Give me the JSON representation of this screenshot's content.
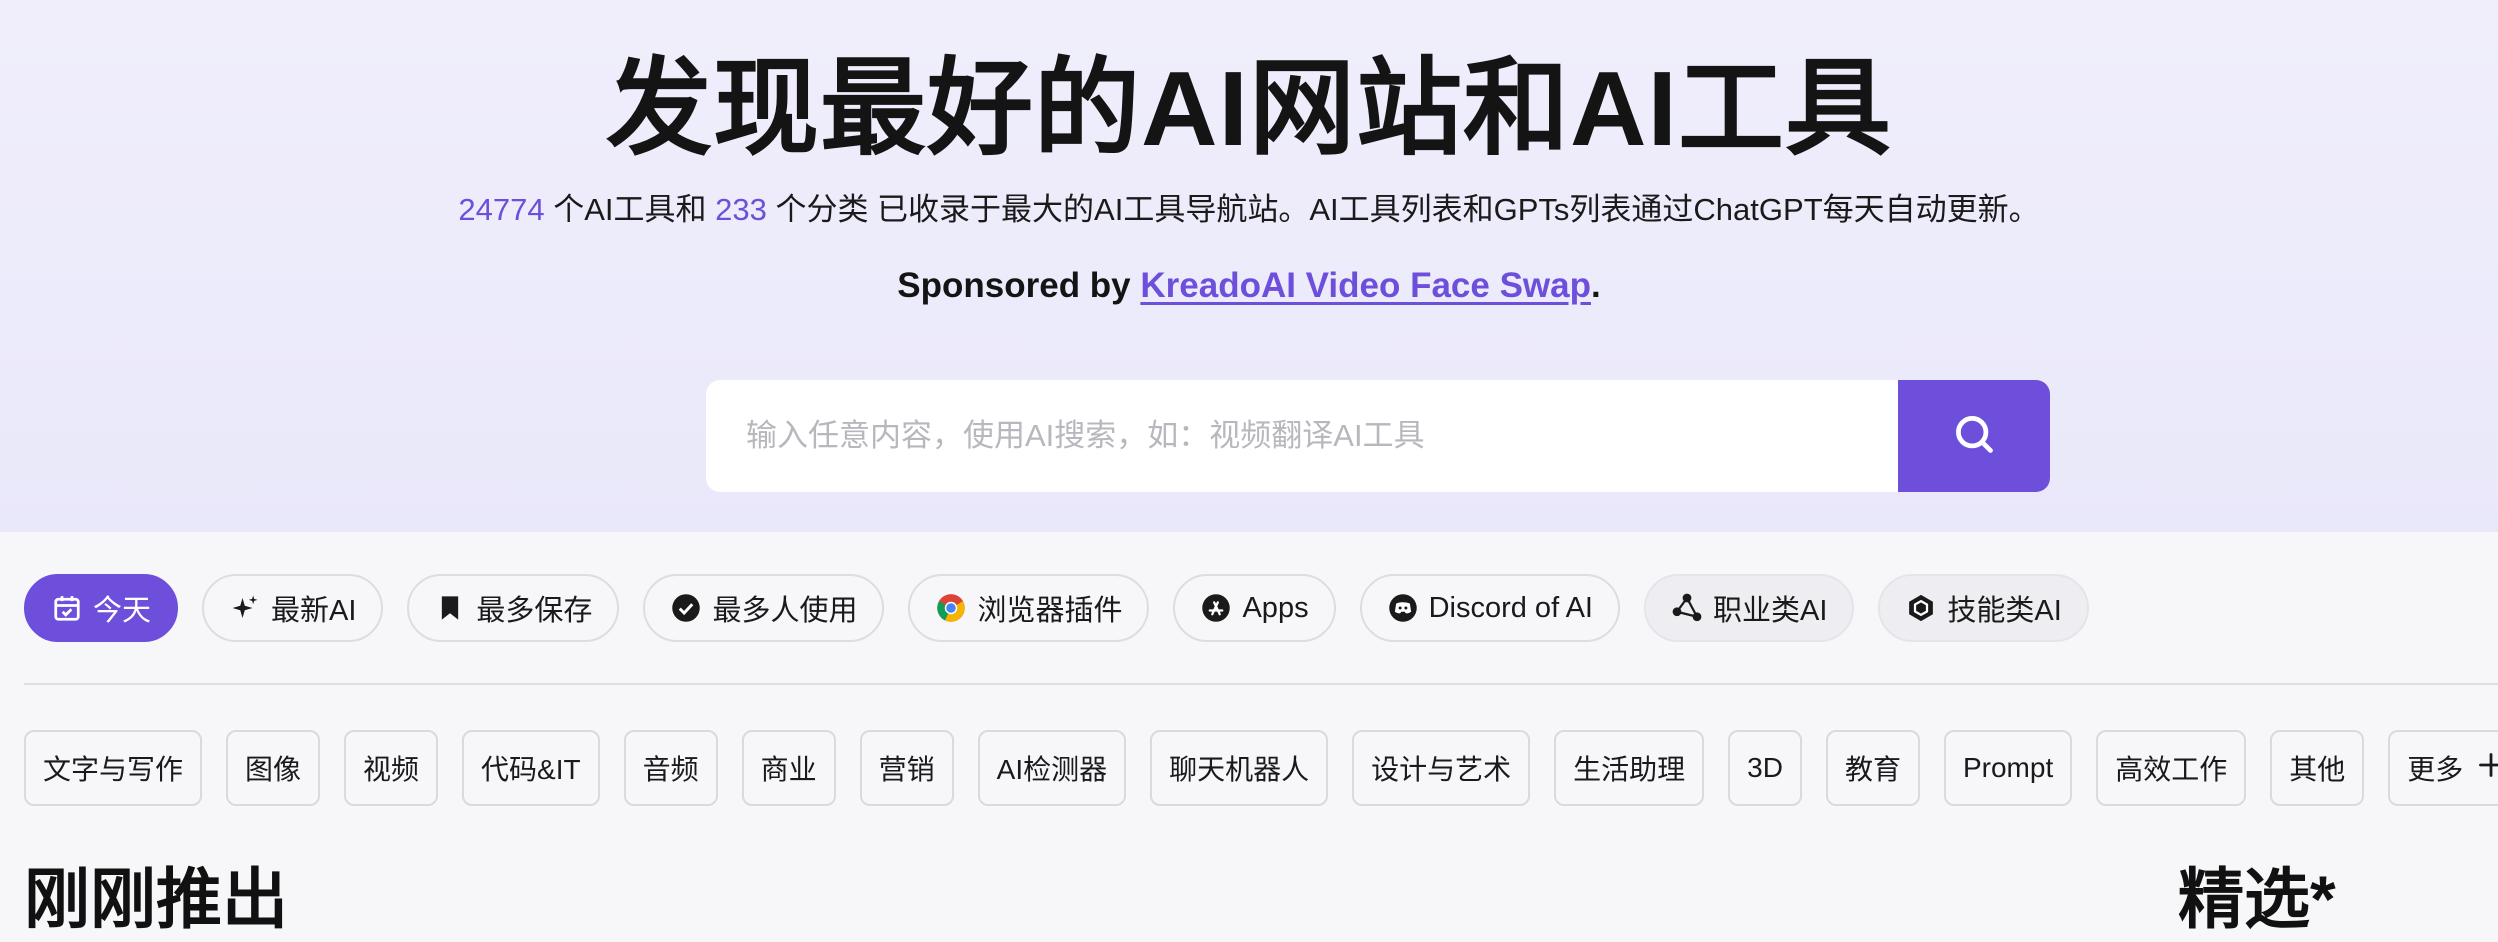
{
  "hero": {
    "title": "发现最好的AI网站和AI工具",
    "tool_count": "24774",
    "tool_count_suffix": " 个AI工具和 ",
    "category_count": "233",
    "stats_suffix": " 个分类 已收录于最大的AI工具导航站。AI工具列表和GPTs列表通过ChatGPT每天自动更新。",
    "sponsor_prefix": "Sponsored by ",
    "sponsor_link": "KreadoAI Video Face Swap",
    "sponsor_suffix": "."
  },
  "search": {
    "placeholder": "输入任意内容，使用AI搜索，如：视频翻译AI工具",
    "icon": "search-icon"
  },
  "filter_tabs": [
    {
      "label": "今天",
      "icon": "calendar-check-icon",
      "active": true
    },
    {
      "label": "最新AI",
      "icon": "sparkles-icon"
    },
    {
      "label": "最多保存",
      "icon": "bookmark-icon"
    },
    {
      "label": "最多人使用",
      "icon": "check-circle-icon"
    },
    {
      "label": "浏览器插件",
      "icon": "chrome-icon"
    },
    {
      "label": "Apps",
      "icon": "app-store-icon"
    },
    {
      "label": "Discord of AI",
      "icon": "discord-icon"
    },
    {
      "label": "职业类AI",
      "icon": "network-icon"
    },
    {
      "label": "技能类AI",
      "icon": "hexagon-icon"
    }
  ],
  "categories": [
    "文字与写作",
    "图像",
    "视频",
    "代码&IT",
    "音频",
    "商业",
    "营销",
    "AI检测器",
    "聊天机器人",
    "设计与艺术",
    "生活助理",
    "3D",
    "教育",
    "Prompt",
    "高效工作",
    "其他"
  ],
  "more_label": "更多",
  "sections": {
    "left_title": "刚刚推出",
    "right_title": "精选*"
  },
  "colors": {
    "accent": "#6d4fdb",
    "hero_bg": "#eeecfb",
    "page_bg": "#f7f7fa"
  }
}
